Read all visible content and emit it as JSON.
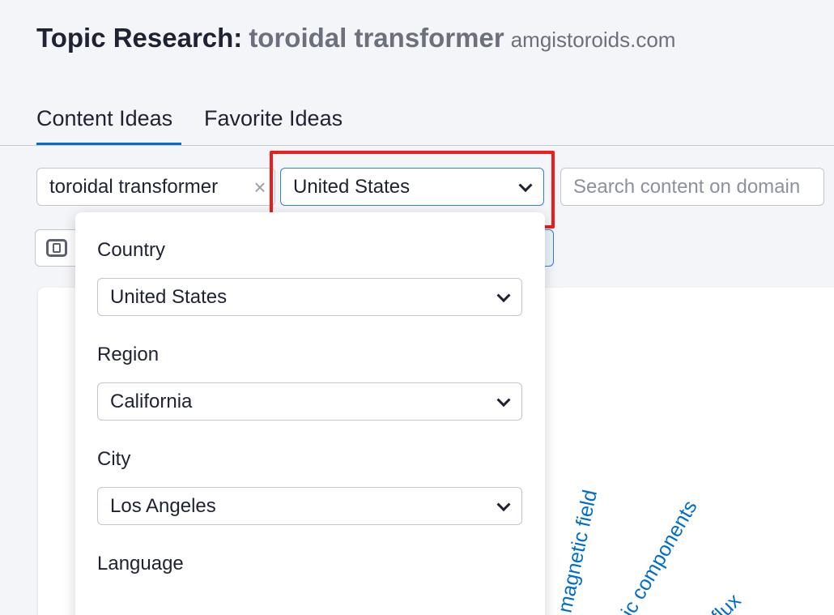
{
  "header": {
    "title_prefix": "Topic Research:",
    "keyword": "toroidal transformer",
    "domain": "amgistoroids.com"
  },
  "tabs": [
    {
      "label": "Content Ideas",
      "active": true
    },
    {
      "label": "Favorite Ideas",
      "active": false
    }
  ],
  "toolbar": {
    "keyword_value": "toroidal transformer",
    "clear_glyph": "×",
    "country_value": "United States",
    "domain_search_placeholder": "Search content on domain"
  },
  "location_dropdown": {
    "country_label": "Country",
    "country_value": "United States",
    "region_label": "Region",
    "region_value": "California",
    "city_label": "City",
    "city_value": "Los Angeles",
    "language_label": "Language"
  },
  "topic_cloud": {
    "words": [
      "magnetic field",
      "nic components",
      "c flux"
    ]
  },
  "colors": {
    "accent": "#006dca",
    "highlight": "#ee1c1c",
    "background": "#f4f5f9",
    "text": "#1e2232",
    "muted": "#6c707c"
  },
  "icons": {
    "clear": "close-icon",
    "dropdown": "chevron-down-icon",
    "view": "card-view-icon"
  }
}
